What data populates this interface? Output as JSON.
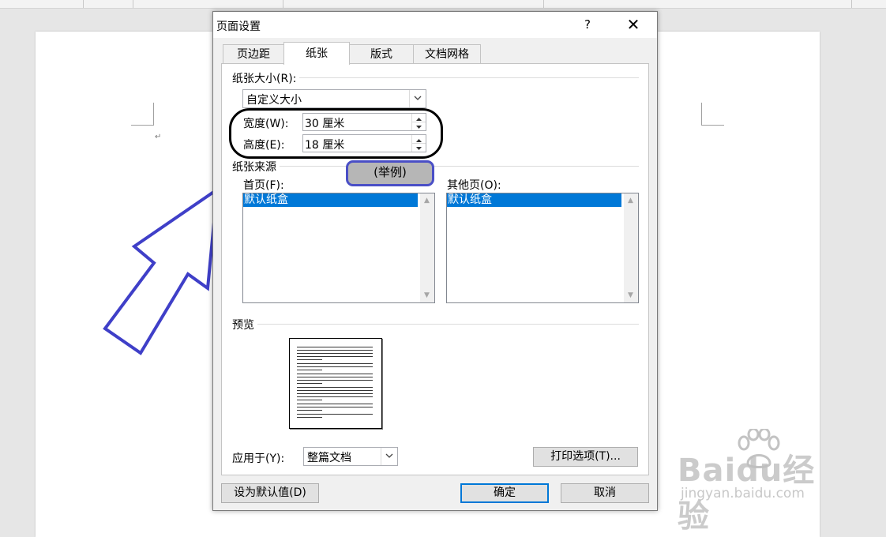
{
  "dialog": {
    "title": "页面设置",
    "help": "?",
    "close": "✕",
    "tabs": [
      {
        "label": "页边距",
        "active": false
      },
      {
        "label": "纸张",
        "active": true
      },
      {
        "label": "版式",
        "active": false
      },
      {
        "label": "文档网格",
        "active": false
      }
    ],
    "paper_size": {
      "label": "纸张大小(R):",
      "selected": "自定义大小",
      "width_label": "宽度(W):",
      "width_value": "30 厘米",
      "height_label": "高度(E):",
      "height_value": "18 厘米"
    },
    "paper_source": {
      "label": "纸张来源",
      "first_page_label": "首页(F):",
      "first_page_items": [
        "默认纸盒"
      ],
      "other_pages_label": "其他页(O):",
      "other_pages_items": [
        "默认纸盒"
      ]
    },
    "preview_label": "预览",
    "apply_to_label": "应用于(Y):",
    "apply_to_value": "整篇文档",
    "print_options": "打印选项(T)...",
    "set_default": "设为默认值(D)",
    "ok": "确定",
    "cancel": "取消"
  },
  "annotation": {
    "badge": "(举例)",
    "colors": {
      "arrow": "#3f3fc8",
      "ellipse": "#000000"
    }
  },
  "watermark": {
    "logo": "Baidu经验",
    "url": "jingyan.baidu.com"
  },
  "colors": {
    "selection": "#0078d7",
    "dialog_bg": "#f0f0f0",
    "workspace": "#e6e6e6"
  }
}
